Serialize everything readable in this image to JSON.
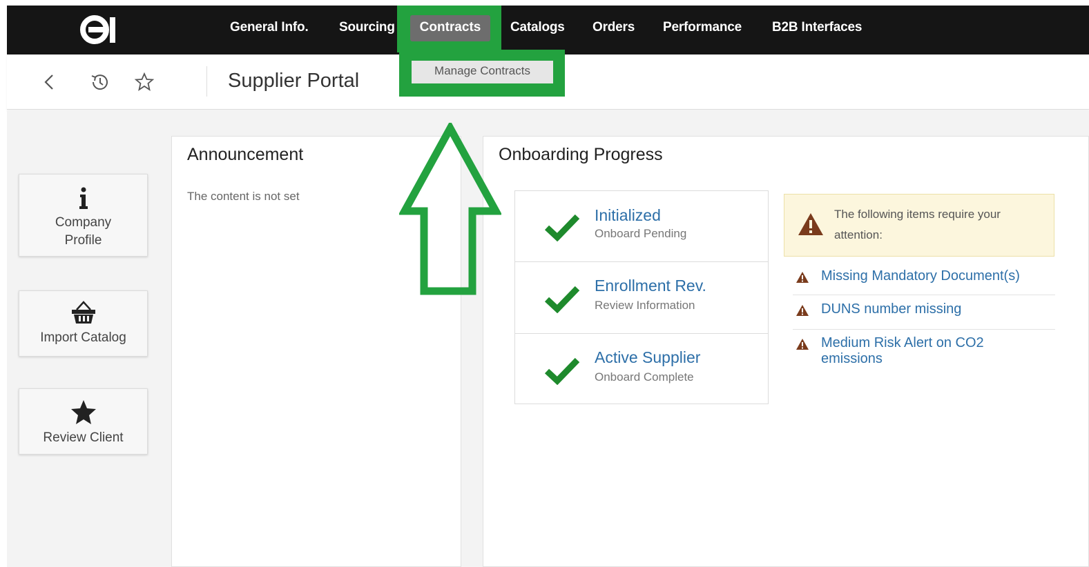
{
  "nav": {
    "items": [
      {
        "label": "General Info."
      },
      {
        "label": "Sourcing"
      },
      {
        "label": "Contracts"
      },
      {
        "label": "Catalogs"
      },
      {
        "label": "Orders"
      },
      {
        "label": "Performance"
      },
      {
        "label": "B2B Interfaces"
      }
    ],
    "dropdown_item": "Manage Contracts"
  },
  "toolbar": {
    "back_icon": "chevron-left-icon",
    "history_icon": "history-icon",
    "favorite_icon": "star-outline-icon",
    "page_title": "Supplier Portal"
  },
  "sidebar": {
    "buttons": [
      {
        "label_line1": "Company",
        "label_line2": "Profile",
        "icon": "info-icon"
      },
      {
        "label": "Import Catalog",
        "icon": "basket-icon"
      },
      {
        "label": "Review Client",
        "icon": "star-icon"
      }
    ]
  },
  "announcement": {
    "title": "Announcement",
    "text": "The content is not set"
  },
  "onboarding": {
    "title": "Onboarding Progress",
    "steps": [
      {
        "title": "Initialized",
        "subtitle": "Onboard Pending"
      },
      {
        "title": "Enrollment Rev.",
        "subtitle": "Review Information"
      },
      {
        "title": "Active Supplier",
        "subtitle": "Onboard Complete"
      }
    ],
    "alert_text": "The following items require your attention:",
    "issues": [
      {
        "text": "Missing Mandatory Document(s)"
      },
      {
        "text": "DUNS number missing"
      },
      {
        "text_line1": "Medium Risk Alert on CO2",
        "text_line2": "emissions"
      }
    ]
  },
  "colors": {
    "highlight": "#23a23f",
    "nav_bg": "#151515",
    "link": "#2d6fa8",
    "check": "#1e8a2c",
    "warning": "#7a3b1c"
  }
}
